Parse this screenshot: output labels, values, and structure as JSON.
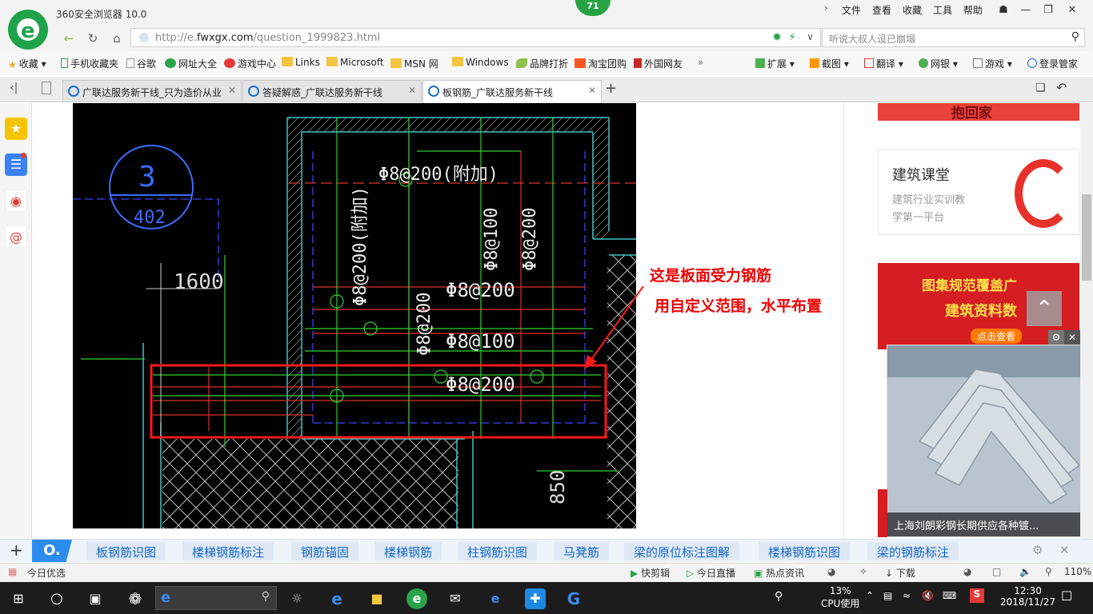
{
  "browser": {
    "title": "360安全浏览器 10.0",
    "badge": "71",
    "menus": [
      "文件",
      "查看",
      "收藏",
      "工具",
      "帮助"
    ],
    "url_prefix": "http://e.",
    "url_domain": "fwxgx.com",
    "url_path": "/question_1999823.html",
    "search_placeholder": "听说大叔人设已崩塌"
  },
  "bookmarks": [
    "收藏",
    "手机收藏夹",
    "谷歌",
    "网址大全",
    "游戏中心",
    "Links",
    "Microsoft",
    "MSN 网",
    "Windows",
    "品牌打折",
    "淘宝团购",
    "外国网友"
  ],
  "toolbar_right": [
    "扩展",
    "截图",
    "翻译",
    "网银",
    "游戏",
    "登录管家"
  ],
  "tabs": [
    {
      "label": "广联达服务新干线_只为造价从业"
    },
    {
      "label": "答疑解惑_广联达服务新干线"
    },
    {
      "label": "板钢筋_广联达服务新干线"
    }
  ],
  "cad": {
    "circle_top": "3",
    "circle_bottom": "402",
    "dim_1600": "1600",
    "dim_850": "850",
    "r1": "Φ8@200(附加)",
    "r2": "Φ8@200(附加)",
    "r3": "Φ8@100",
    "r4": "Φ8@200",
    "r5": "Φ8@200",
    "r6": "Φ8@200",
    "r7": "Φ8@100",
    "r8": "Φ8@200"
  },
  "annotation": {
    "line1": "这是板面受力钢筋",
    "line2": "用自定义范围，水平布置"
  },
  "ads": {
    "top_text": "抱回家",
    "course_title": "建筑课堂",
    "course_desc1": "建筑行业实训教",
    "course_desc2": "学第一平台",
    "promo_l1": "图集规范覆盖广",
    "promo_l2": "建筑资料数",
    "promo_l3": "点击查看",
    "popup_caption": "上海刘朗彩钢长期供应各种镀..."
  },
  "keywords": [
    "板钢筋识图",
    "楼梯钢筋标注",
    "钢筋锚固",
    "楼梯钢筋",
    "柱钢筋识图",
    "马凳筋",
    "梁的原位标注图解",
    "楼梯钢筋识图",
    "梁的钢筋标注"
  ],
  "status": {
    "left": "今日优选",
    "items": [
      "快剪辑",
      "今日直播",
      "热点资讯",
      "下载"
    ],
    "zoom": "110%"
  },
  "taskbar": {
    "cpu_pct": "13%",
    "cpu_label": "CPU使用",
    "time": "12:30",
    "date": "2018/11/27"
  }
}
